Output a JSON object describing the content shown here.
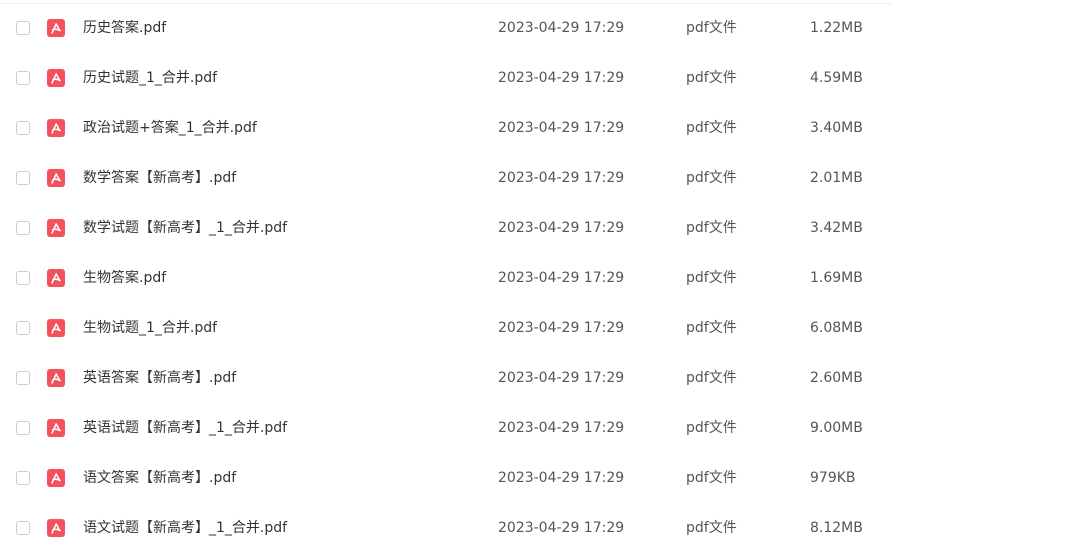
{
  "files": [
    {
      "name": "历史答案.pdf",
      "date": "2023-04-29 17:29",
      "type": "pdf文件",
      "size": "1.22MB",
      "icon": "pdf-file-icon"
    },
    {
      "name": "历史试题_1_合并.pdf",
      "date": "2023-04-29 17:29",
      "type": "pdf文件",
      "size": "4.59MB",
      "icon": "pdf-file-icon"
    },
    {
      "name": "政治试题+答案_1_合并.pdf",
      "date": "2023-04-29 17:29",
      "type": "pdf文件",
      "size": "3.40MB",
      "icon": "pdf-file-icon"
    },
    {
      "name": "数学答案【新高考】.pdf",
      "date": "2023-04-29 17:29",
      "type": "pdf文件",
      "size": "2.01MB",
      "icon": "pdf-file-icon"
    },
    {
      "name": "数学试题【新高考】_1_合并.pdf",
      "date": "2023-04-29 17:29",
      "type": "pdf文件",
      "size": "3.42MB",
      "icon": "pdf-file-icon"
    },
    {
      "name": "生物答案.pdf",
      "date": "2023-04-29 17:29",
      "type": "pdf文件",
      "size": "1.69MB",
      "icon": "pdf-file-icon"
    },
    {
      "name": "生物试题_1_合并.pdf",
      "date": "2023-04-29 17:29",
      "type": "pdf文件",
      "size": "6.08MB",
      "icon": "pdf-file-icon"
    },
    {
      "name": "英语答案【新高考】.pdf",
      "date": "2023-04-29 17:29",
      "type": "pdf文件",
      "size": "2.60MB",
      "icon": "pdf-file-icon"
    },
    {
      "name": "英语试题【新高考】_1_合并.pdf",
      "date": "2023-04-29 17:29",
      "type": "pdf文件",
      "size": "9.00MB",
      "icon": "pdf-file-icon"
    },
    {
      "name": "语文答案【新高考】.pdf",
      "date": "2023-04-29 17:29",
      "type": "pdf文件",
      "size": "979KB",
      "icon": "pdf-file-icon"
    },
    {
      "name": "语文试题【新高考】_1_合并.pdf",
      "date": "2023-04-29 17:29",
      "type": "pdf文件",
      "size": "8.12MB",
      "icon": "pdf-file-icon"
    }
  ],
  "colors": {
    "pdf_icon": "#f3525c",
    "text": "#333333",
    "muted_text": "#555555",
    "checkbox_border": "#c9ccd3"
  }
}
